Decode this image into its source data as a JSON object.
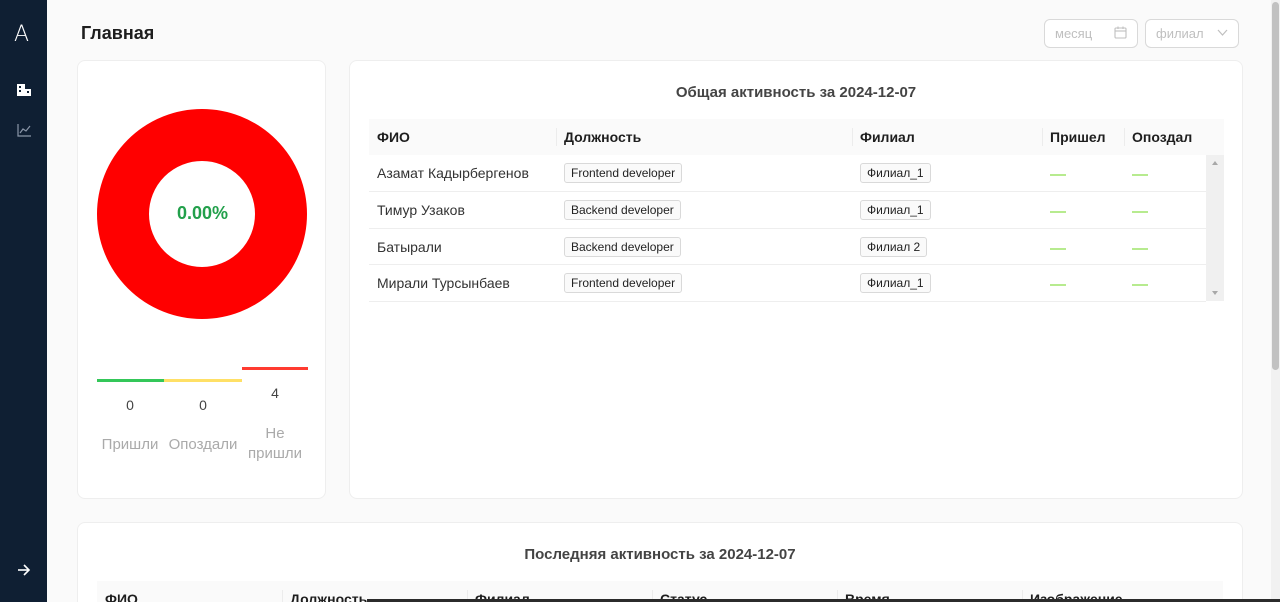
{
  "sidebar": {
    "logo": "A",
    "items": [
      {
        "icon": "building-icon"
      },
      {
        "icon": "chart-line-icon"
      }
    ],
    "footer_icon": "arrow-right-icon"
  },
  "header": {
    "title": "Главная",
    "month_placeholder": "месяц",
    "branch_placeholder": "филиал"
  },
  "donut": {
    "percent_text": "0.00%",
    "ring_color": "#ff0000",
    "percent_color": "#22a04b"
  },
  "stats": [
    {
      "value": "0",
      "label": "Пришли",
      "color": "#34c759"
    },
    {
      "value": "0",
      "label": "Опоздали",
      "color": "#ffe066"
    },
    {
      "value": "4",
      "label": "Не пришли",
      "color": "#ff3b30"
    }
  ],
  "activity": {
    "title": "Общая активность за 2024-12-07",
    "columns": [
      "ФИО",
      "Должность",
      "Филиал",
      "Пришел",
      "Опоздал"
    ],
    "rows": [
      {
        "name": "Азамат Кадырбергенов",
        "position": "Frontend developer",
        "branch": "Филиал_1",
        "came": "—",
        "late": "—"
      },
      {
        "name": "Тимур Узаков",
        "position": "Backend developer",
        "branch": "Филиал_1",
        "came": "—",
        "late": "—"
      },
      {
        "name": "Батырали",
        "position": "Backend developer",
        "branch": "Филиал 2",
        "came": "—",
        "late": "—"
      },
      {
        "name": "Мирали Турсынбаев",
        "position": "Frontend developer",
        "branch": "Филиал_1",
        "came": "—",
        "late": "—"
      }
    ]
  },
  "last_activity": {
    "title": "Последняя активность за 2024-12-07",
    "columns": [
      "ФИО",
      "Должность",
      "Филиал",
      "Статус",
      "Время",
      "Изображение"
    ]
  }
}
